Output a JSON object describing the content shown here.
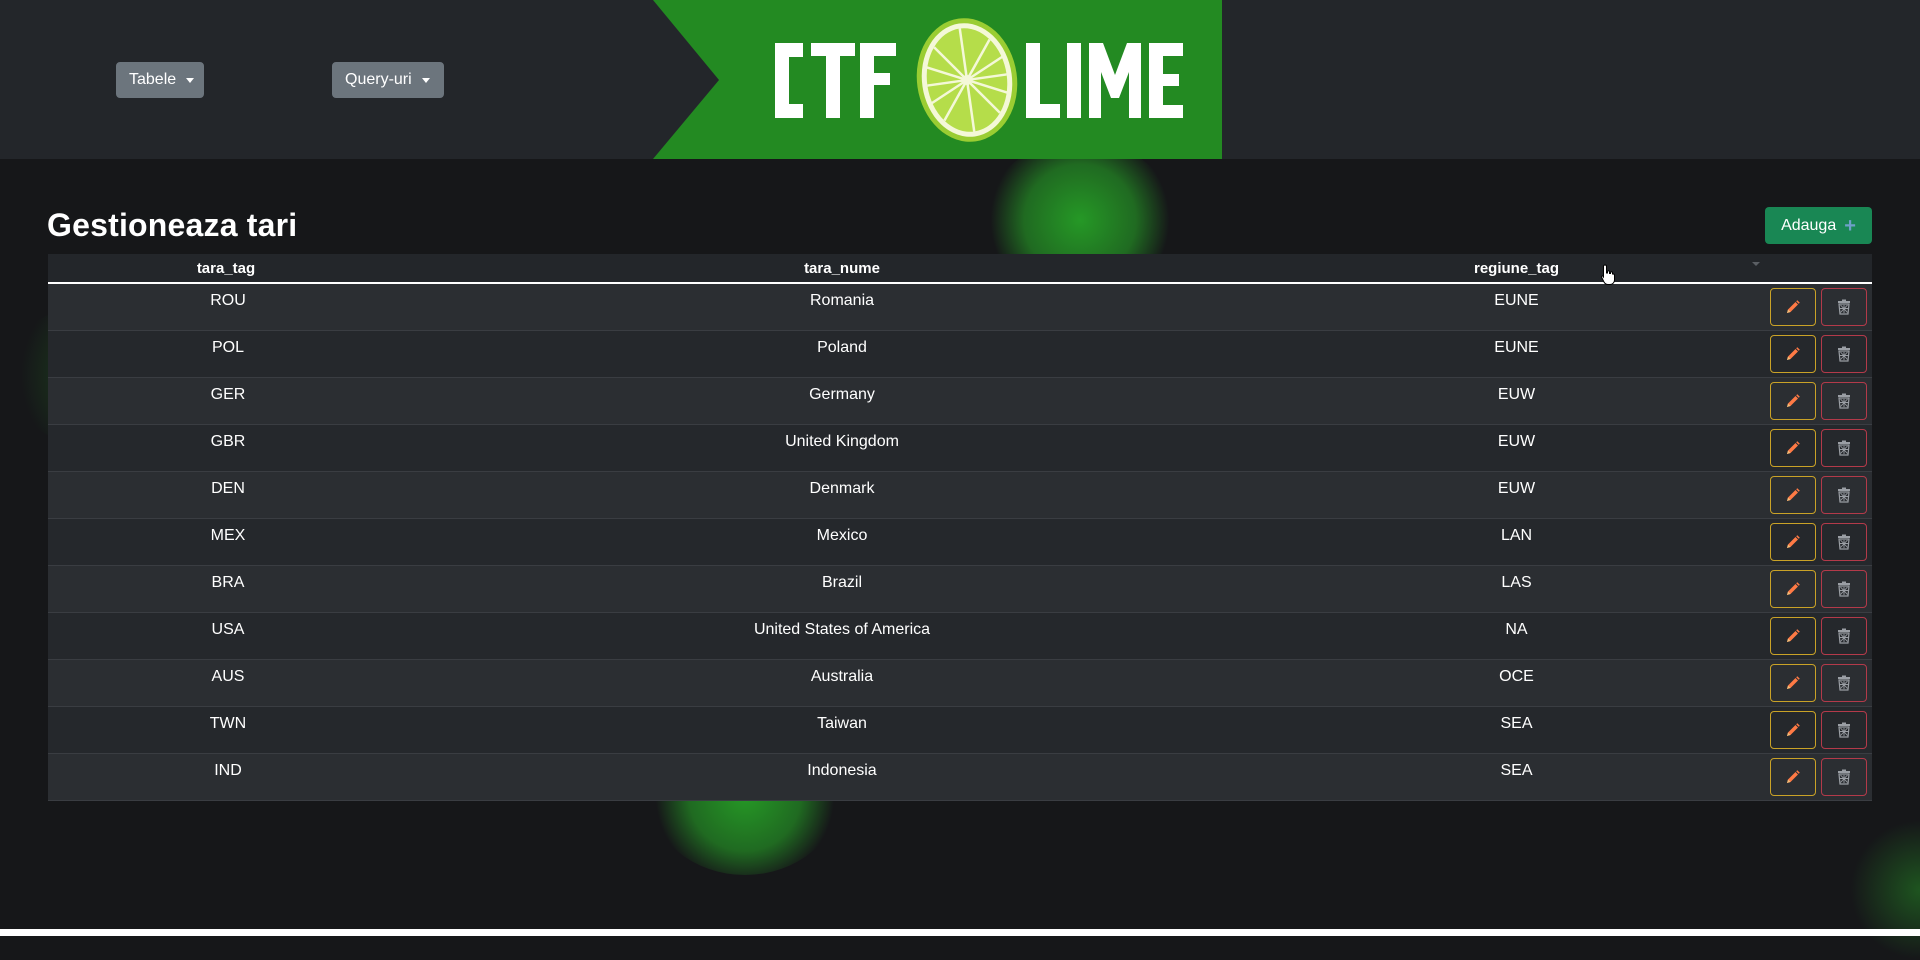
{
  "nav": {
    "dropdowns": [
      {
        "label": "Tabele"
      },
      {
        "label": "Query-uri"
      }
    ],
    "logo_text": "CTF LIME"
  },
  "page": {
    "title": "Gestioneaza tari",
    "add_button_label": "Adauga",
    "add_icon": "plus-icon"
  },
  "table": {
    "columns": [
      "tara_tag",
      "tara_nume",
      "regiune_tag"
    ],
    "rows": [
      {
        "tara_tag": "ROU",
        "tara_nume": "Romania",
        "regiune_tag": "EUNE"
      },
      {
        "tara_tag": "POL",
        "tara_nume": "Poland",
        "regiune_tag": "EUNE"
      },
      {
        "tara_tag": "GER",
        "tara_nume": "Germany",
        "regiune_tag": "EUW"
      },
      {
        "tara_tag": "GBR",
        "tara_nume": "United Kingdom",
        "regiune_tag": "EUW"
      },
      {
        "tara_tag": "DEN",
        "tara_nume": "Denmark",
        "regiune_tag": "EUW"
      },
      {
        "tara_tag": "MEX",
        "tara_nume": "Mexico",
        "regiune_tag": "LAN"
      },
      {
        "tara_tag": "BRA",
        "tara_nume": "Brazil",
        "regiune_tag": "LAS"
      },
      {
        "tara_tag": "USA",
        "tara_nume": "United States of America",
        "regiune_tag": "NA"
      },
      {
        "tara_tag": "AUS",
        "tara_nume": "Australia",
        "regiune_tag": "OCE"
      },
      {
        "tara_tag": "TWN",
        "tara_nume": "Taiwan",
        "regiune_tag": "SEA"
      },
      {
        "tara_tag": "IND",
        "tara_nume": "Indonesia",
        "regiune_tag": "SEA"
      }
    ],
    "row_action_icons": [
      "pencil-icon",
      "trash-icon"
    ]
  },
  "colors": {
    "banner_green": "#238a22",
    "add_button": "#198754",
    "edit_border": "#c9a227",
    "delete_border": "#b33a4a",
    "header_bg": "#23262a",
    "page_bg": "#161719"
  }
}
